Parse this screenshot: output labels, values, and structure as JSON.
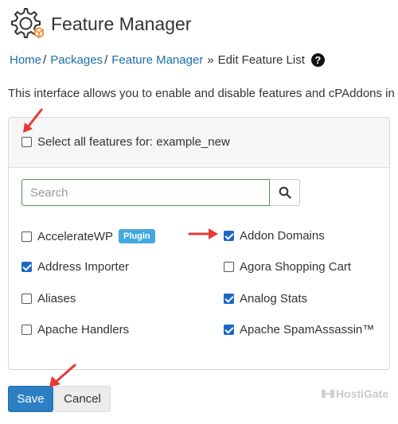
{
  "header": {
    "title": "Feature Manager",
    "icon": "feature-manager-icon"
  },
  "breadcrumb": {
    "items": [
      "Home",
      "Packages",
      "Feature Manager"
    ],
    "separator": "/",
    "last_separator": "»",
    "current": "Edit Feature List",
    "help_glyph": "?"
  },
  "intro": "This interface allows you to enable and disable features and cPAddons in",
  "select_all": {
    "label": "Select all features for: example_new",
    "checked": false
  },
  "search": {
    "placeholder": "Search",
    "value": ""
  },
  "features": [
    {
      "label": "AccelerateWP",
      "checked": false,
      "badge": "Plugin"
    },
    {
      "label": "Addon Domains",
      "checked": true
    },
    {
      "label": "Address Importer",
      "checked": true
    },
    {
      "label": "Agora Shopping Cart",
      "checked": false
    },
    {
      "label": "Aliases",
      "checked": false
    },
    {
      "label": "Analog Stats",
      "checked": true
    },
    {
      "label": "Apache Handlers",
      "checked": false
    },
    {
      "label": "Apache SpamAssassin™",
      "checked": true
    }
  ],
  "buttons": {
    "save": "Save",
    "cancel": "Cancel"
  },
  "watermark": "HostiGate",
  "colors": {
    "accent": "#2d7fc4",
    "link": "#1b6ea8",
    "checkbox": "#1b67c7",
    "badge": "#41a8e0",
    "arrow": "#e53935"
  }
}
